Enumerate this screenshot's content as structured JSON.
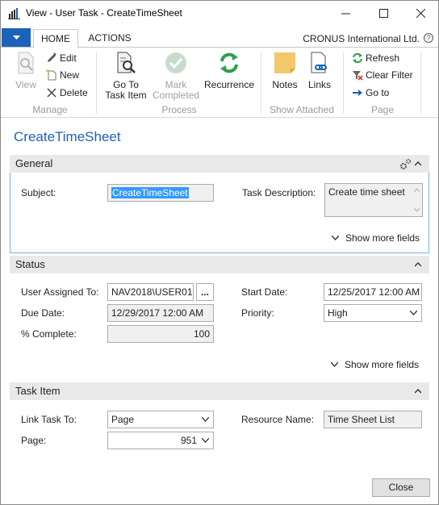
{
  "window": {
    "title": "View - User Task - CreateTimeSheet"
  },
  "ribbon": {
    "tabs": [
      "HOME",
      "ACTIONS"
    ],
    "company": "CRONUS International Ltd.",
    "help": "?",
    "manage": {
      "view": "View",
      "edit": "Edit",
      "new": "New",
      "delete": "Delete",
      "group_label": "Manage"
    },
    "process": {
      "go_to_task_item": [
        "Go To",
        "Task Item"
      ],
      "mark_completed": [
        "Mark",
        "Completed"
      ],
      "recurrence": "Recurrence",
      "group_label": "Process"
    },
    "show_attached": {
      "notes": "Notes",
      "links": "Links",
      "group_label": "Show Attached"
    },
    "page": {
      "refresh": "Refresh",
      "clear_filter": "Clear Filter",
      "go_to": "Go to",
      "group_label": "Page"
    }
  },
  "page_title": "CreateTimeSheet",
  "general": {
    "title": "General",
    "subject_label": "Subject:",
    "subject_value": "CreateTimeSheet",
    "task_description_label": "Task Description:",
    "task_description_value": "Create time sheet",
    "show_more": "Show more fields"
  },
  "status": {
    "title": "Status",
    "user_assigned_label": "User Assigned To:",
    "user_assigned_value": "NAV2018\\USER01",
    "lookup_button": "...",
    "due_date_label": "Due Date:",
    "due_date_value": "12/29/2017 12:00 AM",
    "percent_complete_label": "% Complete:",
    "percent_complete_value": "100",
    "start_date_label": "Start Date:",
    "start_date_value": "12/25/2017 12:00 AM",
    "priority_label": "Priority:",
    "priority_value": "High",
    "show_more": "Show more fields"
  },
  "task_item": {
    "title": "Task Item",
    "link_task_label": "Link Task To:",
    "link_task_value": "Page",
    "page_label": "Page:",
    "page_value": "951",
    "resource_name_label": "Resource Name:",
    "resource_name_value": "Time Sheet List"
  },
  "footer": {
    "close": "Close"
  },
  "colors": {
    "accent": "#1c62b9",
    "section_header": "#e9e9e9",
    "selection": "#3399ff",
    "ribbon_green": "#2e9e4f",
    "notes_yellow": "#f3c86b"
  }
}
